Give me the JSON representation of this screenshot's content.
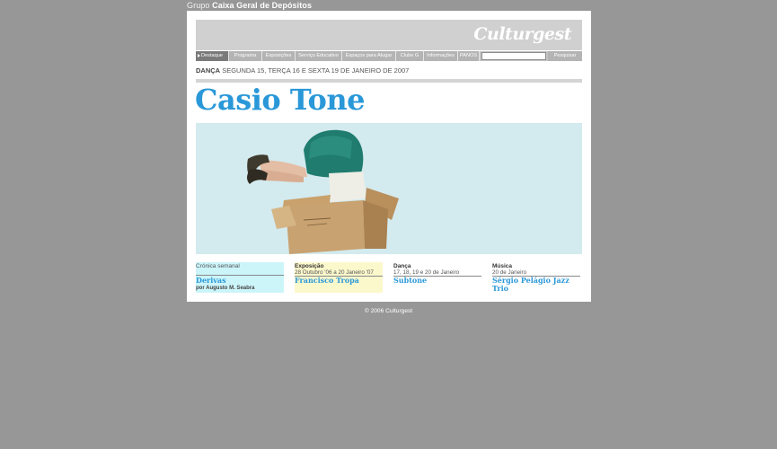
{
  "group_header": {
    "prefix": "Grupo",
    "name": "Caixa Geral de Depósitos"
  },
  "logo": "Culturgest",
  "nav": {
    "items": [
      "Destaque",
      "Programa",
      "Exposições",
      "Serviço Educativo",
      "Espaços para Alugar",
      "Clube G",
      "Informações",
      "PANOS"
    ],
    "search_placeholder": "",
    "search_button": "Pesquisar"
  },
  "event": {
    "category": "DANÇA",
    "dates": "SEGUNDA 15, TERÇA 16 E SEXTA 19 DE JANEIRO DE 2007",
    "title": "Casio Tone"
  },
  "cards": [
    {
      "category": "Crónica semanal",
      "dates": "",
      "name": "Derivas",
      "byline": "por Augusto M. Seabra",
      "bg": "#ccf5fa"
    },
    {
      "category": "Exposição",
      "dates": "28 Outubro '06 a 20 Janeiro '07",
      "name": "Francisco Tropa",
      "byline": "",
      "bg": "#fbf8cc"
    },
    {
      "category": "Dança",
      "dates": "17, 18, 19 e 20 de Janeiro",
      "name": "Subtone",
      "byline": "",
      "bg": "#ffffff"
    },
    {
      "category": "Música",
      "dates": "20 de Janeiro",
      "name": "Sérgio Pelágio Jazz\nTrio",
      "byline": "",
      "bg": "#ffffff"
    }
  ],
  "footer": "© 2006 Culturgest",
  "colors": {
    "accent": "#2a98d8",
    "background": "#979797"
  }
}
